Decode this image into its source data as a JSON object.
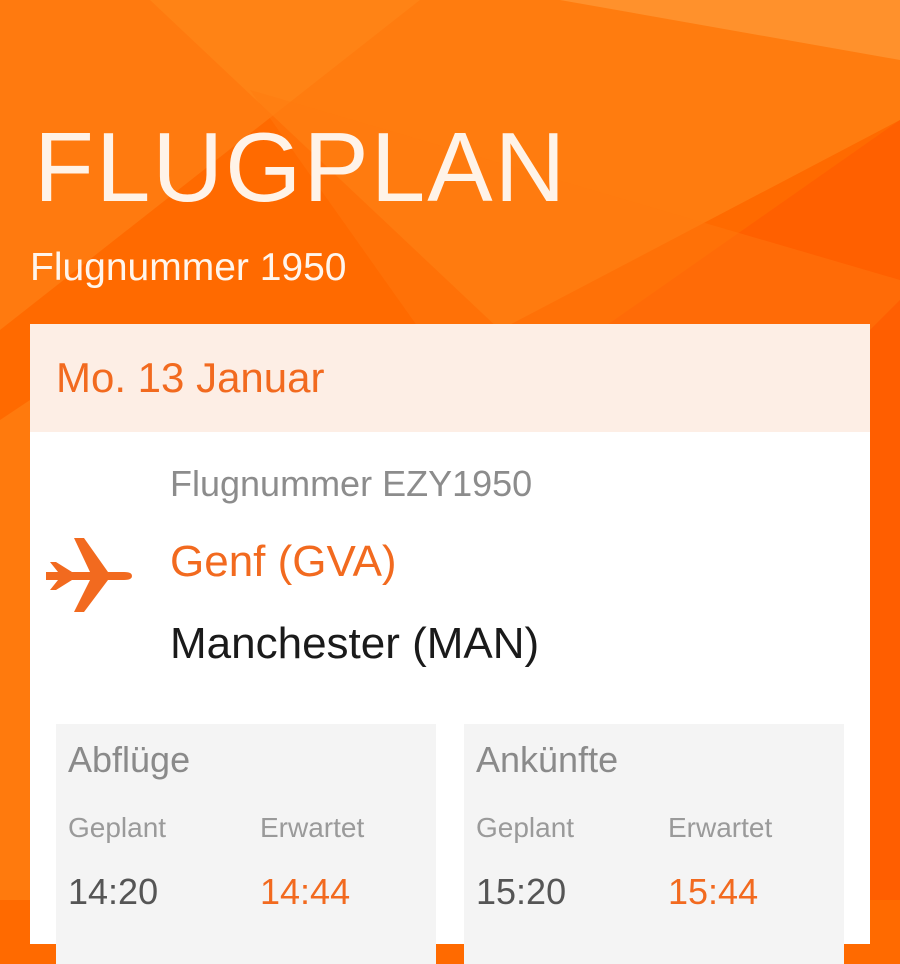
{
  "colors": {
    "brand_orange": "#ff6a00",
    "accent_text": "#f26a1f",
    "date_bar": "#fdeee5",
    "panel_bg": "#f4f4f4"
  },
  "header": {
    "title": "FLUGPLAN",
    "subtitle": "Flugnummer 1950"
  },
  "flight": {
    "date": "Mo. 13 Januar",
    "number": "Flugnummer EZY1950",
    "origin": "Genf (GVA)",
    "destination": "Manchester (MAN)",
    "icon": "airplane-icon"
  },
  "departures": {
    "heading": "Abflüge",
    "scheduled_label": "Geplant",
    "expected_label": "Erwartet",
    "scheduled_time": "14:20",
    "expected_time": "14:44"
  },
  "arrivals": {
    "heading": "Ankünfte",
    "scheduled_label": "Geplant",
    "expected_label": "Erwartet",
    "scheduled_time": "15:20",
    "expected_time": "15:44"
  }
}
